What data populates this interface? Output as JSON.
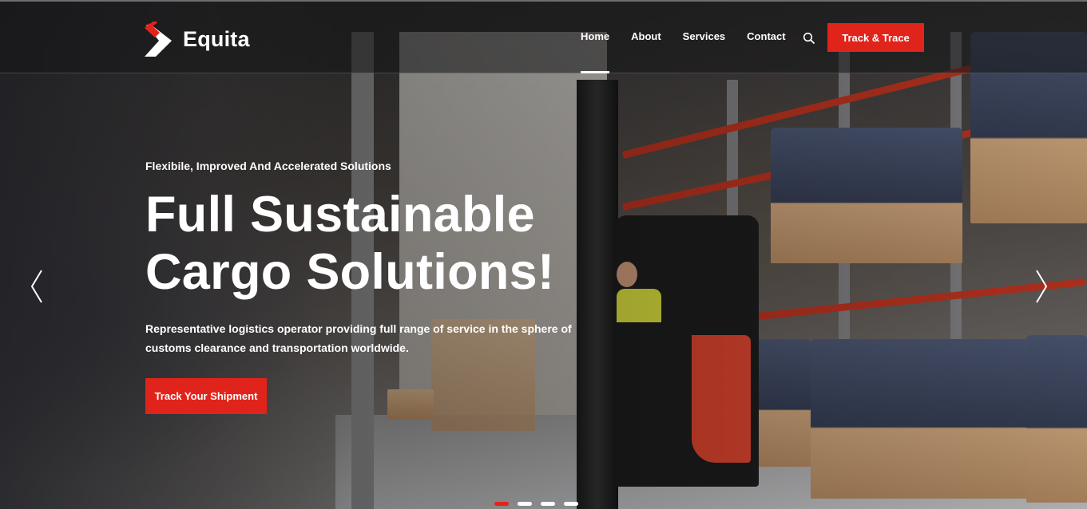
{
  "brand": {
    "name": "Equita",
    "accent": "#e1241b"
  },
  "nav": {
    "items": [
      {
        "label": "Home",
        "active": true
      },
      {
        "label": "About",
        "active": false
      },
      {
        "label": "Services",
        "active": false
      },
      {
        "label": "Contact",
        "active": false
      }
    ],
    "search_icon": "search-icon",
    "cta_label": "Track & Trace"
  },
  "hero": {
    "eyebrow": "Flexibile, Improved And Accelerated Solutions",
    "headline_line1": "Full Sustainable",
    "headline_line2": "Cargo Solutions!",
    "description": "Representative logistics operator providing full range of service in the sphere of customs clearance and transportation worldwide.",
    "cta_label": "Track Your Shipment",
    "prev_icon": "chevron-left-icon",
    "next_icon": "chevron-right-icon",
    "slides": 4,
    "active_slide": 1
  }
}
